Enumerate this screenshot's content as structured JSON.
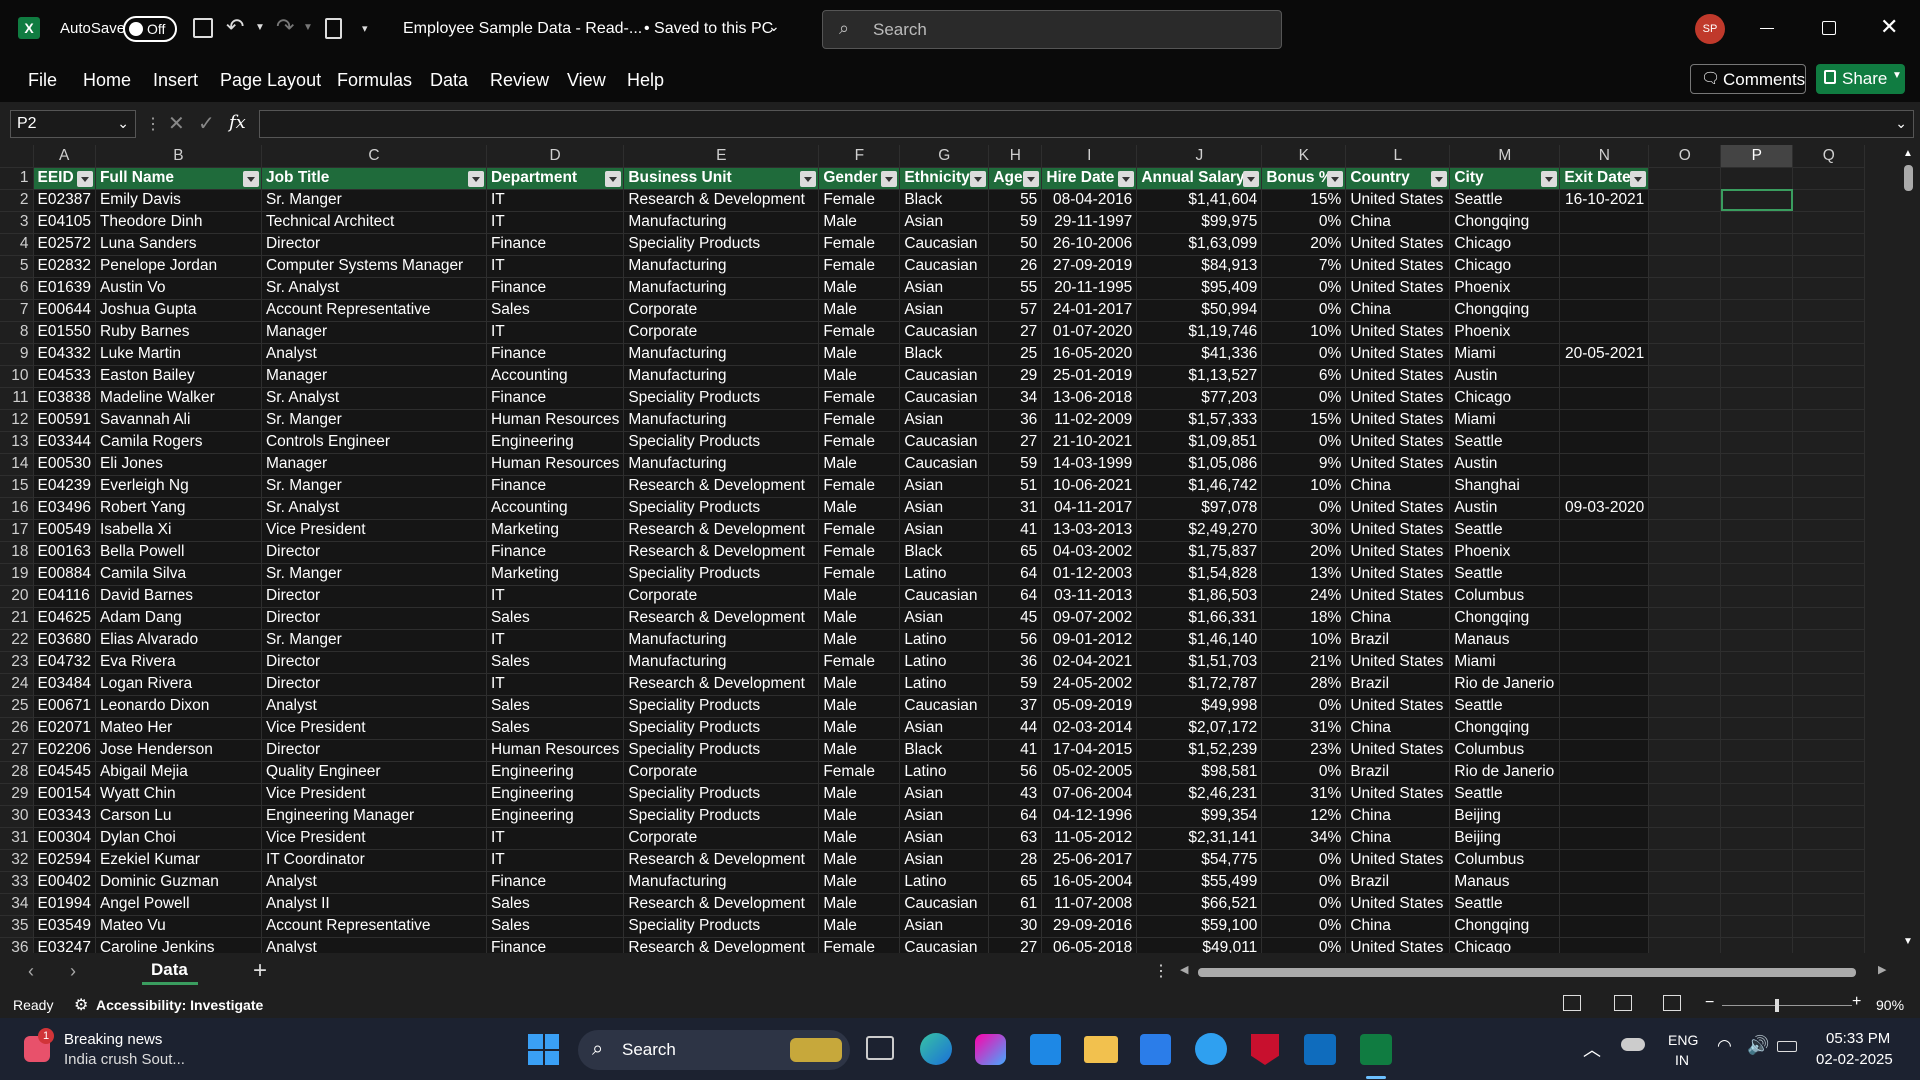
{
  "titlebar": {
    "autosave_label": "AutoSave",
    "autosave_state": "Off",
    "doc_title": "Employee Sample Data - Read-...",
    "saved_status": "• Saved to this PC",
    "search_placeholder": "Search",
    "avatar_initials": "SP"
  },
  "menu": {
    "items": [
      "File",
      "Home",
      "Insert",
      "Page Layout",
      "Formulas",
      "Data",
      "Review",
      "View",
      "Help"
    ],
    "comments_label": "Comments",
    "share_label": "Share"
  },
  "formula_bar": {
    "name_box": "P2",
    "fx_label": "fx",
    "value": ""
  },
  "columns": [
    "A",
    "B",
    "C",
    "D",
    "E",
    "F",
    "G",
    "H",
    "I",
    "J",
    "K",
    "L",
    "M",
    "N",
    "O",
    "P",
    "Q"
  ],
  "selected_column": "P",
  "selected_cell": "P2",
  "table_headers": [
    "EEID",
    "Full Name",
    "Job Title",
    "Department",
    "Business Unit",
    "Gender",
    "Ethnicity",
    "Age",
    "Hire Date",
    "Annual Salary",
    "Bonus %",
    "Country",
    "City",
    "Exit Date"
  ],
  "rows": [
    [
      "E02387",
      "Emily Davis",
      "Sr. Manger",
      "IT",
      "Research & Development",
      "Female",
      "Black",
      "55",
      "08-04-2016",
      "$1,41,604",
      "15%",
      "United States",
      "Seattle",
      "16-10-2021"
    ],
    [
      "E04105",
      "Theodore Dinh",
      "Technical Architect",
      "IT",
      "Manufacturing",
      "Male",
      "Asian",
      "59",
      "29-11-1997",
      "$99,975",
      "0%",
      "China",
      "Chongqing",
      ""
    ],
    [
      "E02572",
      "Luna Sanders",
      "Director",
      "Finance",
      "Speciality Products",
      "Female",
      "Caucasian",
      "50",
      "26-10-2006",
      "$1,63,099",
      "20%",
      "United States",
      "Chicago",
      ""
    ],
    [
      "E02832",
      "Penelope Jordan",
      "Computer Systems Manager",
      "IT",
      "Manufacturing",
      "Female",
      "Caucasian",
      "26",
      "27-09-2019",
      "$84,913",
      "7%",
      "United States",
      "Chicago",
      ""
    ],
    [
      "E01639",
      "Austin Vo",
      "Sr. Analyst",
      "Finance",
      "Manufacturing",
      "Male",
      "Asian",
      "55",
      "20-11-1995",
      "$95,409",
      "0%",
      "United States",
      "Phoenix",
      ""
    ],
    [
      "E00644",
      "Joshua Gupta",
      "Account Representative",
      "Sales",
      "Corporate",
      "Male",
      "Asian",
      "57",
      "24-01-2017",
      "$50,994",
      "0%",
      "China",
      "Chongqing",
      ""
    ],
    [
      "E01550",
      "Ruby Barnes",
      "Manager",
      "IT",
      "Corporate",
      "Female",
      "Caucasian",
      "27",
      "01-07-2020",
      "$1,19,746",
      "10%",
      "United States",
      "Phoenix",
      ""
    ],
    [
      "E04332",
      "Luke Martin",
      "Analyst",
      "Finance",
      "Manufacturing",
      "Male",
      "Black",
      "25",
      "16-05-2020",
      "$41,336",
      "0%",
      "United States",
      "Miami",
      "20-05-2021"
    ],
    [
      "E04533",
      "Easton Bailey",
      "Manager",
      "Accounting",
      "Manufacturing",
      "Male",
      "Caucasian",
      "29",
      "25-01-2019",
      "$1,13,527",
      "6%",
      "United States",
      "Austin",
      ""
    ],
    [
      "E03838",
      "Madeline Walker",
      "Sr. Analyst",
      "Finance",
      "Speciality Products",
      "Female",
      "Caucasian",
      "34",
      "13-06-2018",
      "$77,203",
      "0%",
      "United States",
      "Chicago",
      ""
    ],
    [
      "E00591",
      "Savannah Ali",
      "Sr. Manger",
      "Human Resources",
      "Manufacturing",
      "Female",
      "Asian",
      "36",
      "11-02-2009",
      "$1,57,333",
      "15%",
      "United States",
      "Miami",
      ""
    ],
    [
      "E03344",
      "Camila Rogers",
      "Controls Engineer",
      "Engineering",
      "Speciality Products",
      "Female",
      "Caucasian",
      "27",
      "21-10-2021",
      "$1,09,851",
      "0%",
      "United States",
      "Seattle",
      ""
    ],
    [
      "E00530",
      "Eli Jones",
      "Manager",
      "Human Resources",
      "Manufacturing",
      "Male",
      "Caucasian",
      "59",
      "14-03-1999",
      "$1,05,086",
      "9%",
      "United States",
      "Austin",
      ""
    ],
    [
      "E04239",
      "Everleigh Ng",
      "Sr. Manger",
      "Finance",
      "Research & Development",
      "Female",
      "Asian",
      "51",
      "10-06-2021",
      "$1,46,742",
      "10%",
      "China",
      "Shanghai",
      ""
    ],
    [
      "E03496",
      "Robert Yang",
      "Sr. Analyst",
      "Accounting",
      "Speciality Products",
      "Male",
      "Asian",
      "31",
      "04-11-2017",
      "$97,078",
      "0%",
      "United States",
      "Austin",
      "09-03-2020"
    ],
    [
      "E00549",
      "Isabella Xi",
      "Vice President",
      "Marketing",
      "Research & Development",
      "Female",
      "Asian",
      "41",
      "13-03-2013",
      "$2,49,270",
      "30%",
      "United States",
      "Seattle",
      ""
    ],
    [
      "E00163",
      "Bella Powell",
      "Director",
      "Finance",
      "Research & Development",
      "Female",
      "Black",
      "65",
      "04-03-2002",
      "$1,75,837",
      "20%",
      "United States",
      "Phoenix",
      ""
    ],
    [
      "E00884",
      "Camila Silva",
      "Sr. Manger",
      "Marketing",
      "Speciality Products",
      "Female",
      "Latino",
      "64",
      "01-12-2003",
      "$1,54,828",
      "13%",
      "United States",
      "Seattle",
      ""
    ],
    [
      "E04116",
      "David Barnes",
      "Director",
      "IT",
      "Corporate",
      "Male",
      "Caucasian",
      "64",
      "03-11-2013",
      "$1,86,503",
      "24%",
      "United States",
      "Columbus",
      ""
    ],
    [
      "E04625",
      "Adam Dang",
      "Director",
      "Sales",
      "Research & Development",
      "Male",
      "Asian",
      "45",
      "09-07-2002",
      "$1,66,331",
      "18%",
      "China",
      "Chongqing",
      ""
    ],
    [
      "E03680",
      "Elias Alvarado",
      "Sr. Manger",
      "IT",
      "Manufacturing",
      "Male",
      "Latino",
      "56",
      "09-01-2012",
      "$1,46,140",
      "10%",
      "Brazil",
      "Manaus",
      ""
    ],
    [
      "E04732",
      "Eva Rivera",
      "Director",
      "Sales",
      "Manufacturing",
      "Female",
      "Latino",
      "36",
      "02-04-2021",
      "$1,51,703",
      "21%",
      "United States",
      "Miami",
      ""
    ],
    [
      "E03484",
      "Logan Rivera",
      "Director",
      "IT",
      "Research & Development",
      "Male",
      "Latino",
      "59",
      "24-05-2002",
      "$1,72,787",
      "28%",
      "Brazil",
      "Rio de Janerio",
      ""
    ],
    [
      "E00671",
      "Leonardo Dixon",
      "Analyst",
      "Sales",
      "Speciality Products",
      "Male",
      "Caucasian",
      "37",
      "05-09-2019",
      "$49,998",
      "0%",
      "United States",
      "Seattle",
      ""
    ],
    [
      "E02071",
      "Mateo Her",
      "Vice President",
      "Sales",
      "Speciality Products",
      "Male",
      "Asian",
      "44",
      "02-03-2014",
      "$2,07,172",
      "31%",
      "China",
      "Chongqing",
      ""
    ],
    [
      "E02206",
      "Jose Henderson",
      "Director",
      "Human Resources",
      "Speciality Products",
      "Male",
      "Black",
      "41",
      "17-04-2015",
      "$1,52,239",
      "23%",
      "United States",
      "Columbus",
      ""
    ],
    [
      "E04545",
      "Abigail Mejia",
      "Quality Engineer",
      "Engineering",
      "Corporate",
      "Female",
      "Latino",
      "56",
      "05-02-2005",
      "$98,581",
      "0%",
      "Brazil",
      "Rio de Janerio",
      ""
    ],
    [
      "E00154",
      "Wyatt Chin",
      "Vice President",
      "Engineering",
      "Speciality Products",
      "Male",
      "Asian",
      "43",
      "07-06-2004",
      "$2,46,231",
      "31%",
      "United States",
      "Seattle",
      ""
    ],
    [
      "E03343",
      "Carson Lu",
      "Engineering Manager",
      "Engineering",
      "Speciality Products",
      "Male",
      "Asian",
      "64",
      "04-12-1996",
      "$99,354",
      "12%",
      "China",
      "Beijing",
      ""
    ],
    [
      "E00304",
      "Dylan Choi",
      "Vice President",
      "IT",
      "Corporate",
      "Male",
      "Asian",
      "63",
      "11-05-2012",
      "$2,31,141",
      "34%",
      "China",
      "Beijing",
      ""
    ],
    [
      "E02594",
      "Ezekiel Kumar",
      "IT Coordinator",
      "IT",
      "Research & Development",
      "Male",
      "Asian",
      "28",
      "25-06-2017",
      "$54,775",
      "0%",
      "United States",
      "Columbus",
      ""
    ],
    [
      "E00402",
      "Dominic Guzman",
      "Analyst",
      "Finance",
      "Manufacturing",
      "Male",
      "Latino",
      "65",
      "16-05-2004",
      "$55,499",
      "0%",
      "Brazil",
      "Manaus",
      ""
    ],
    [
      "E01994",
      "Angel Powell",
      "Analyst II",
      "Sales",
      "Research & Development",
      "Male",
      "Caucasian",
      "61",
      "11-07-2008",
      "$66,521",
      "0%",
      "United States",
      "Seattle",
      ""
    ],
    [
      "E03549",
      "Mateo Vu",
      "Account Representative",
      "Sales",
      "Speciality Products",
      "Male",
      "Asian",
      "30",
      "29-09-2016",
      "$59,100",
      "0%",
      "China",
      "Chongqing",
      ""
    ],
    [
      "E03247",
      "Caroline Jenkins",
      "Analyst",
      "Finance",
      "Research & Development",
      "Female",
      "Caucasian",
      "27",
      "06-05-2018",
      "$49,011",
      "0%",
      "United States",
      "Chicago",
      ""
    ]
  ],
  "sheet_tabs": {
    "active": "Data"
  },
  "status": {
    "ready": "Ready",
    "accessibility": "Accessibility: Investigate",
    "zoom": "90%"
  },
  "taskbar": {
    "news_title": "Breaking news",
    "news_sub": "India crush Sout...",
    "news_badge": "1",
    "search_label": "Search",
    "lang1": "ENG",
    "lang2": "IN",
    "time": "05:33 PM",
    "date": "02-02-2025"
  },
  "colors": {
    "accent": "#1f6b3b",
    "excel_green": "#107c41",
    "selection": "#3a9d5f"
  }
}
